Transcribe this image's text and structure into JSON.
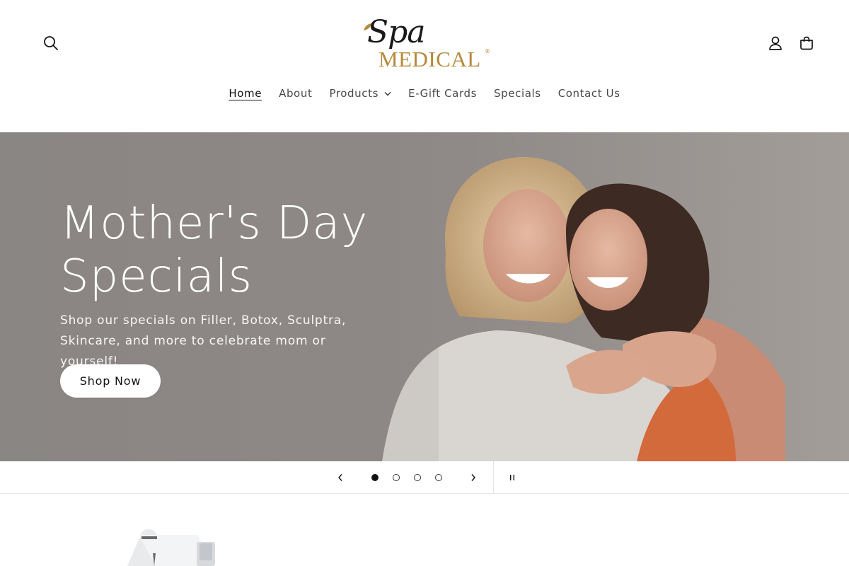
{
  "header": {
    "logo_text_top": "Spa",
    "logo_text_bottom": "MEDICAL",
    "logo_reg": "®",
    "nav": [
      {
        "label": "Home",
        "active": true
      },
      {
        "label": "About"
      },
      {
        "label": "Products",
        "has_dropdown": true
      },
      {
        "label": "E-Gift Cards"
      },
      {
        "label": "Specials"
      },
      {
        "label": "Contact Us"
      }
    ],
    "icons": [
      "search-icon",
      "account-icon",
      "cart-icon"
    ]
  },
  "hero": {
    "title": "Mother's Day Specials",
    "text": "Shop our specials on Filler, Botox, Sculptra, Skincare, and more to celebrate mom or yourself!",
    "button_label": "Shop Now"
  },
  "slider": {
    "slide_count": 4,
    "active_slide": 1,
    "icons": [
      "chevron-left-icon",
      "chevron-right-icon",
      "pause-icon"
    ]
  },
  "colors": {
    "logo_gold": "#b68a3a",
    "hero_bg": "#8b8784",
    "text": "#121212"
  }
}
